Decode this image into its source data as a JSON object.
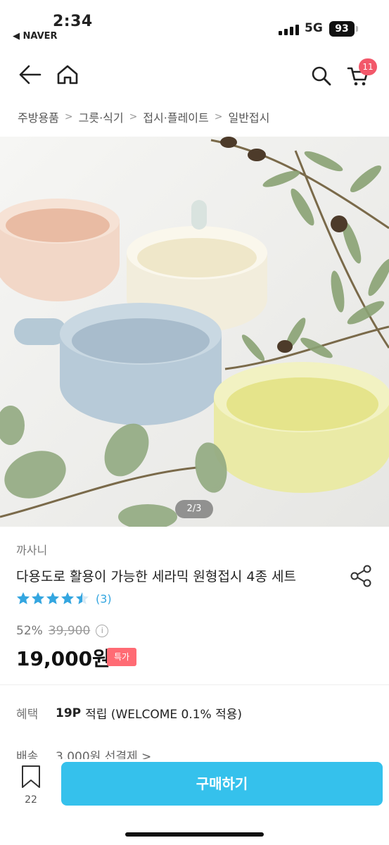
{
  "status": {
    "time": "2:34",
    "back_app": "◀ NAVER",
    "network": "5G",
    "battery": "93"
  },
  "nav": {
    "cart_count": "11"
  },
  "breadcrumb": [
    "주방용품",
    "그릇·식기",
    "접시·플레이트",
    "일반접시"
  ],
  "gallery": {
    "pager": "2/3"
  },
  "product": {
    "brand": "까사니",
    "title": "다용도로 활용이 가능한 세라믹 원형접시 4종 세트",
    "rating_stars": 4.5,
    "review_count": "(3)",
    "discount": "52%",
    "original_price": "39,900",
    "price": "19,000원",
    "badge": "특가"
  },
  "benefit": {
    "label": "혜택",
    "points": "19P",
    "text": "적립 (WELCOME 0.1% 적용)"
  },
  "shipping": {
    "label": "배송",
    "text": "3,000원 선결제 >"
  },
  "bottom": {
    "bookmark_count": "22",
    "buy_label": "구매하기"
  },
  "colors": {
    "accent": "#35c1ec",
    "badge": "#ff6b74",
    "star": "#34a6e0",
    "cart_badge": "#f2586a"
  }
}
